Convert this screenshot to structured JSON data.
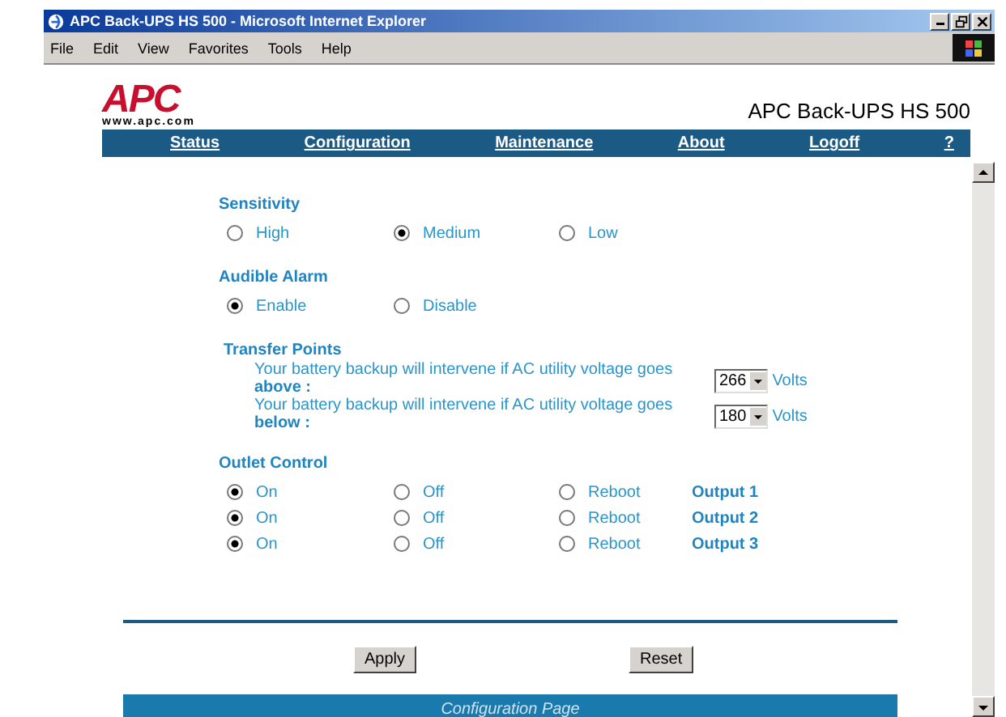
{
  "window": {
    "title": "APC Back-UPS HS 500 - Microsoft Internet Explorer"
  },
  "menu": [
    "File",
    "Edit",
    "View",
    "Favorites",
    "Tools",
    "Help"
  ],
  "header": {
    "logo": "APC",
    "logo_url": "www.apc.com",
    "product": "APC Back-UPS HS 500"
  },
  "nav": [
    "Status",
    "Configuration",
    "Maintenance",
    "About",
    "Logoff",
    "?"
  ],
  "sensitivity": {
    "title": "Sensitivity",
    "options": [
      {
        "label": "High",
        "selected": false
      },
      {
        "label": "Medium",
        "selected": true
      },
      {
        "label": "Low",
        "selected": false
      }
    ]
  },
  "alarm": {
    "title": "Audible Alarm",
    "options": [
      {
        "label": "Enable",
        "selected": true
      },
      {
        "label": "Disable",
        "selected": false
      }
    ]
  },
  "transfer_points": {
    "title": "Transfer Points",
    "items": [
      {
        "text": "Your battery backup will intervene if AC utility voltage goes",
        "emphasis": "above :",
        "value": "266",
        "unit": "Volts"
      },
      {
        "text": "Your battery backup will intervene if AC utility voltage goes",
        "emphasis": "below :",
        "value": "180",
        "unit": "Volts"
      }
    ]
  },
  "outlet_control": {
    "title": "Outlet Control",
    "rows": [
      {
        "label": "Output 1",
        "options": [
          {
            "label": "On",
            "selected": true
          },
          {
            "label": "Off",
            "selected": false
          },
          {
            "label": "Reboot",
            "selected": false
          }
        ]
      },
      {
        "label": "Output 2",
        "options": [
          {
            "label": "On",
            "selected": true
          },
          {
            "label": "Off",
            "selected": false
          },
          {
            "label": "Reboot",
            "selected": false
          }
        ]
      },
      {
        "label": "Output 3",
        "options": [
          {
            "label": "On",
            "selected": true
          },
          {
            "label": "Off",
            "selected": false
          },
          {
            "label": "Reboot",
            "selected": false
          }
        ]
      }
    ]
  },
  "buttons": [
    "Apply",
    "Reset"
  ],
  "footer": "Configuration Page"
}
